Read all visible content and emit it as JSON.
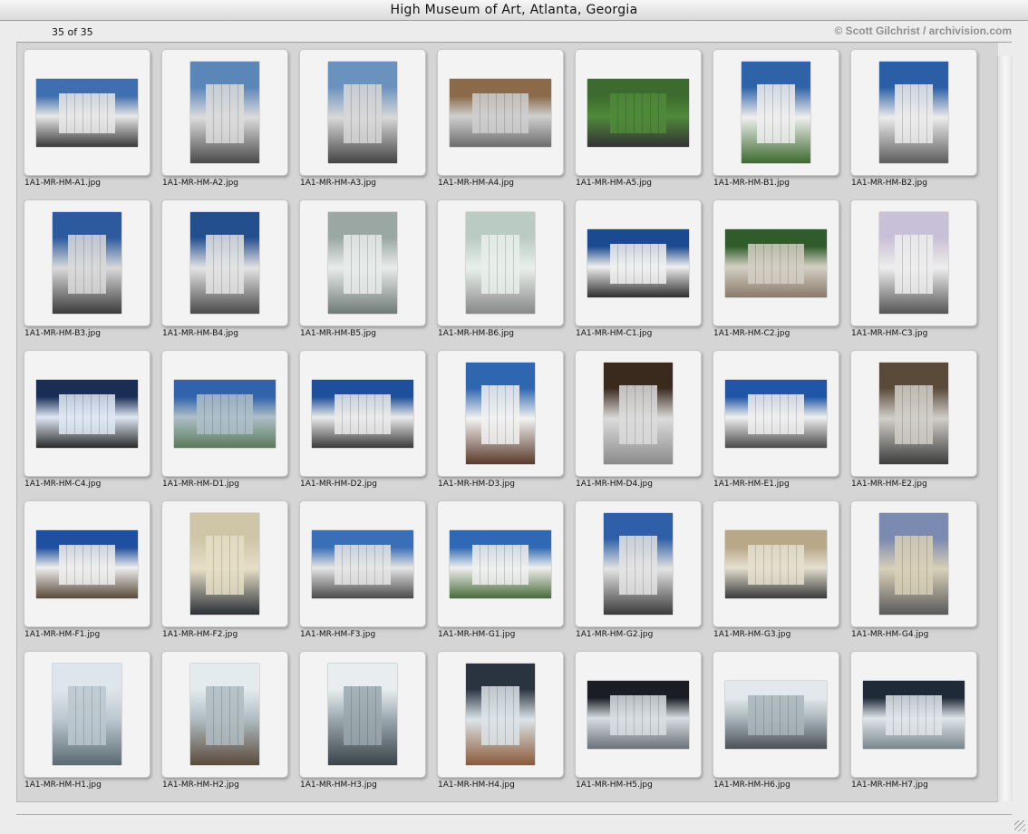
{
  "window": {
    "title": "High Museum of Art, Atlanta, Georgia"
  },
  "header": {
    "counter": "35 of 35",
    "credit": "© Scott Gilchrist / archivision.com"
  },
  "items": [
    {
      "filename": "1A1-MR-HM-A1.jpg",
      "orientation": "landscape",
      "colors": [
        "#3f6fb0",
        "#e8e8e8",
        "#3a3a3a"
      ]
    },
    {
      "filename": "1A1-MR-HM-A2.jpg",
      "orientation": "portrait",
      "colors": [
        "#5a86b8",
        "#dcdcdc",
        "#4a4a4a"
      ]
    },
    {
      "filename": "1A1-MR-HM-A3.jpg",
      "orientation": "portrait",
      "colors": [
        "#6a92bf",
        "#d8d8d8",
        "#444444"
      ]
    },
    {
      "filename": "1A1-MR-HM-A4.jpg",
      "orientation": "landscape",
      "colors": [
        "#8a6a48",
        "#cfcfcf",
        "#6d6d6d"
      ]
    },
    {
      "filename": "1A1-MR-HM-A5.jpg",
      "orientation": "landscape",
      "colors": [
        "#3d6a2e",
        "#4f8a3a",
        "#333333"
      ]
    },
    {
      "filename": "1A1-MR-HM-B1.jpg",
      "orientation": "portrait",
      "colors": [
        "#2f63a8",
        "#efefef",
        "#3d6a2e"
      ]
    },
    {
      "filename": "1A1-MR-HM-B2.jpg",
      "orientation": "portrait",
      "colors": [
        "#2a5ea6",
        "#ececec",
        "#5c5c5c"
      ]
    },
    {
      "filename": "1A1-MR-HM-B3.jpg",
      "orientation": "portrait",
      "colors": [
        "#2b5a9e",
        "#dadada",
        "#3b3b3b"
      ]
    },
    {
      "filename": "1A1-MR-HM-B4.jpg",
      "orientation": "portrait",
      "colors": [
        "#244f8f",
        "#e4e4e4",
        "#4a4a4a"
      ]
    },
    {
      "filename": "1A1-MR-HM-B5.jpg",
      "orientation": "portrait",
      "colors": [
        "#9aa7a3",
        "#e8ecea",
        "#6f7a77"
      ]
    },
    {
      "filename": "1A1-MR-HM-B6.jpg",
      "orientation": "portrait",
      "colors": [
        "#b9cbc3",
        "#e9f0ec",
        "#888888"
      ]
    },
    {
      "filename": "1A1-MR-HM-C1.jpg",
      "orientation": "landscape",
      "colors": [
        "#1c4a91",
        "#f0f0f0",
        "#2e2e2e"
      ]
    },
    {
      "filename": "1A1-MR-HM-C2.jpg",
      "orientation": "landscape",
      "colors": [
        "#2f5c2a",
        "#d4cfc4",
        "#8a7a6a"
      ]
    },
    {
      "filename": "1A1-MR-HM-C3.jpg",
      "orientation": "portrait",
      "colors": [
        "#c8c0d6",
        "#eeeeee",
        "#555555"
      ]
    },
    {
      "filename": "1A1-MR-HM-C4.jpg",
      "orientation": "landscape",
      "colors": [
        "#1a2e55",
        "#dfe8f4",
        "#2a2a2a"
      ]
    },
    {
      "filename": "1A1-MR-HM-D1.jpg",
      "orientation": "landscape",
      "colors": [
        "#2f64ad",
        "#aebfc8",
        "#5a7a5a"
      ]
    },
    {
      "filename": "1A1-MR-HM-D2.jpg",
      "orientation": "landscape",
      "colors": [
        "#1d4f9c",
        "#ebebeb",
        "#3a3a3a"
      ]
    },
    {
      "filename": "1A1-MR-HM-D3.jpg",
      "orientation": "portrait",
      "colors": [
        "#2e66b0",
        "#f2f2f2",
        "#5a3a2a"
      ]
    },
    {
      "filename": "1A1-MR-HM-D4.jpg",
      "orientation": "portrait",
      "colors": [
        "#3a2a1e",
        "#dcdcdc",
        "#8a8a8a"
      ]
    },
    {
      "filename": "1A1-MR-HM-E1.jpg",
      "orientation": "landscape",
      "colors": [
        "#1f56a8",
        "#f0f0f0",
        "#4a4a4a"
      ]
    },
    {
      "filename": "1A1-MR-HM-E2.jpg",
      "orientation": "portrait",
      "colors": [
        "#5a4a3a",
        "#d2cfc8",
        "#3c3c3c"
      ]
    },
    {
      "filename": "1A1-MR-HM-F1.jpg",
      "orientation": "landscape",
      "colors": [
        "#1e4fa0",
        "#efefef",
        "#5a4a3a"
      ]
    },
    {
      "filename": "1A1-MR-HM-F2.jpg",
      "orientation": "portrait",
      "colors": [
        "#cfc6a8",
        "#e6dfc6",
        "#2c3038"
      ]
    },
    {
      "filename": "1A1-MR-HM-F3.jpg",
      "orientation": "landscape",
      "colors": [
        "#3a6fb8",
        "#e6e6e6",
        "#4a4a4a"
      ]
    },
    {
      "filename": "1A1-MR-HM-G1.jpg",
      "orientation": "landscape",
      "colors": [
        "#2f69b5",
        "#f0f0f0",
        "#4a6a3a"
      ]
    },
    {
      "filename": "1A1-MR-HM-G2.jpg",
      "orientation": "portrait",
      "colors": [
        "#2f5fa8",
        "#e4e4e4",
        "#3a3a3a"
      ]
    },
    {
      "filename": "1A1-MR-HM-G3.jpg",
      "orientation": "landscape",
      "colors": [
        "#b8a888",
        "#e6e0d0",
        "#3a3a3a"
      ]
    },
    {
      "filename": "1A1-MR-HM-G4.jpg",
      "orientation": "portrait",
      "colors": [
        "#7a8ab0",
        "#d8d0b8",
        "#5a5a5a"
      ]
    },
    {
      "filename": "1A1-MR-HM-H1.jpg",
      "orientation": "portrait",
      "colors": [
        "#dde6ea",
        "#bcc8cf",
        "#5a6a72"
      ]
    },
    {
      "filename": "1A1-MR-HM-H2.jpg",
      "orientation": "portrait",
      "colors": [
        "#e4ebee",
        "#b0bcc2",
        "#5a4a3a"
      ]
    },
    {
      "filename": "1A1-MR-HM-H3.jpg",
      "orientation": "portrait",
      "colors": [
        "#e8eef0",
        "#9aa8ae",
        "#3a4448"
      ]
    },
    {
      "filename": "1A1-MR-HM-H4.jpg",
      "orientation": "portrait",
      "colors": [
        "#2a3440",
        "#dce4e8",
        "#8a5a3a"
      ]
    },
    {
      "filename": "1A1-MR-HM-H5.jpg",
      "orientation": "landscape",
      "colors": [
        "#1a1e24",
        "#d8dee2",
        "#6a7278"
      ]
    },
    {
      "filename": "1A1-MR-HM-H6.jpg",
      "orientation": "landscape",
      "colors": [
        "#e2e8ec",
        "#aab6bc",
        "#4a5258"
      ]
    },
    {
      "filename": "1A1-MR-HM-H7.jpg",
      "orientation": "landscape",
      "colors": [
        "#1e2a38",
        "#dfe6ea",
        "#7a868c"
      ]
    }
  ]
}
